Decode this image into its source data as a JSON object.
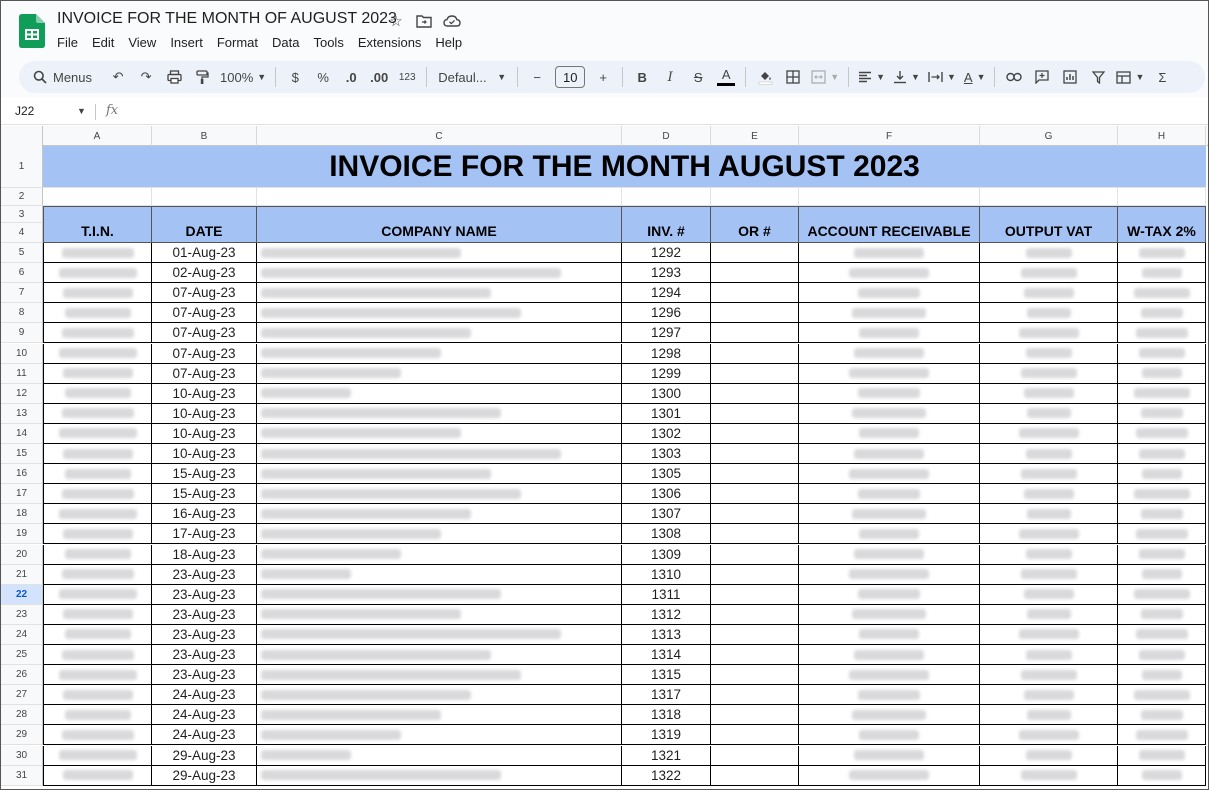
{
  "app": {
    "title": "INVOICE FOR THE MONTH OF AUGUST 2023",
    "menu": [
      "File",
      "Edit",
      "View",
      "Insert",
      "Format",
      "Data",
      "Tools",
      "Extensions",
      "Help"
    ]
  },
  "toolbar": {
    "search_label": "Menus",
    "zoom": "100%",
    "currency": "$",
    "percent": "%",
    "decimal_decrease": ".0",
    "decimal_increase": ".00",
    "number_format": "123",
    "font": "Defaul...",
    "font_size": "10",
    "bold": "B",
    "italic": "I",
    "text_color": "A",
    "sum": "Σ"
  },
  "formula_bar": {
    "name_box": "J22",
    "fx": "fx"
  },
  "columns": [
    "A",
    "B",
    "C",
    "D",
    "E",
    "F",
    "G",
    "H"
  ],
  "sheet": {
    "title": "INVOICE FOR THE MONTH AUGUST 2023",
    "headers": [
      "T.I.N.",
      "DATE",
      "COMPANY NAME",
      "INV. #",
      "OR #",
      "ACCOUNT RECEIVABLE",
      "OUTPUT VAT",
      "W-TAX 2%"
    ],
    "active_row": 22,
    "rows": [
      {
        "row": 5,
        "date": "01-Aug-23",
        "inv": "1292"
      },
      {
        "row": 6,
        "date": "02-Aug-23",
        "inv": "1293"
      },
      {
        "row": 7,
        "date": "07-Aug-23",
        "inv": "1294"
      },
      {
        "row": 8,
        "date": "07-Aug-23",
        "inv": "1296"
      },
      {
        "row": 9,
        "date": "07-Aug-23",
        "inv": "1297"
      },
      {
        "row": 10,
        "date": "07-Aug-23",
        "inv": "1298"
      },
      {
        "row": 11,
        "date": "07-Aug-23",
        "inv": "1299"
      },
      {
        "row": 12,
        "date": "10-Aug-23",
        "inv": "1300"
      },
      {
        "row": 13,
        "date": "10-Aug-23",
        "inv": "1301"
      },
      {
        "row": 14,
        "date": "10-Aug-23",
        "inv": "1302"
      },
      {
        "row": 15,
        "date": "10-Aug-23",
        "inv": "1303"
      },
      {
        "row": 16,
        "date": "15-Aug-23",
        "inv": "1305"
      },
      {
        "row": 17,
        "date": "15-Aug-23",
        "inv": "1306"
      },
      {
        "row": 18,
        "date": "16-Aug-23",
        "inv": "1307"
      },
      {
        "row": 19,
        "date": "17-Aug-23",
        "inv": "1308"
      },
      {
        "row": 20,
        "date": "18-Aug-23",
        "inv": "1309"
      },
      {
        "row": 21,
        "date": "23-Aug-23",
        "inv": "1310"
      },
      {
        "row": 22,
        "date": "23-Aug-23",
        "inv": "1311"
      },
      {
        "row": 23,
        "date": "23-Aug-23",
        "inv": "1312"
      },
      {
        "row": 24,
        "date": "23-Aug-23",
        "inv": "1313"
      },
      {
        "row": 25,
        "date": "23-Aug-23",
        "inv": "1314"
      },
      {
        "row": 26,
        "date": "23-Aug-23",
        "inv": "1315"
      },
      {
        "row": 27,
        "date": "24-Aug-23",
        "inv": "1317"
      },
      {
        "row": 28,
        "date": "24-Aug-23",
        "inv": "1318"
      },
      {
        "row": 29,
        "date": "24-Aug-23",
        "inv": "1319"
      },
      {
        "row": 30,
        "date": "29-Aug-23",
        "inv": "1321"
      },
      {
        "row": 31,
        "date": "29-Aug-23",
        "inv": "1322"
      }
    ]
  }
}
